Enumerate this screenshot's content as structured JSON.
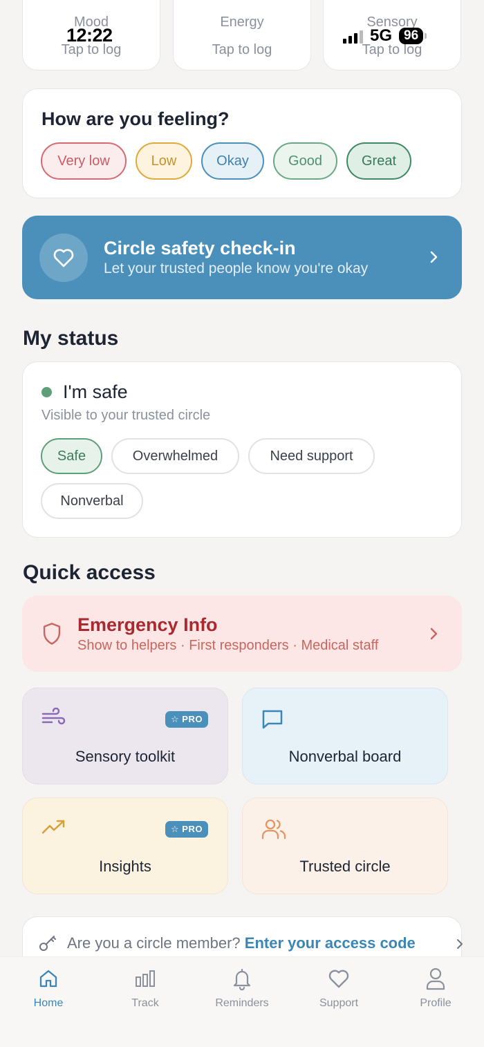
{
  "status_bar": {
    "time": "12:22",
    "network": "5G",
    "battery": "96"
  },
  "trackers": [
    {
      "label": "Mood",
      "action": "Tap to log"
    },
    {
      "label": "Energy",
      "action": "Tap to log"
    },
    {
      "label": "Sensory",
      "action": "Tap to log"
    }
  ],
  "feeling": {
    "title": "How are you feeling?",
    "options": [
      "Very low",
      "Low",
      "Okay",
      "Good",
      "Great"
    ]
  },
  "safety": {
    "title": "Circle safety check-in",
    "subtitle": "Let your trusted people know you're okay"
  },
  "my_status": {
    "heading": "My status",
    "current": "I'm safe",
    "visibility": "Visible to your trusted circle",
    "options": [
      "Safe",
      "Overwhelmed",
      "Need support",
      "Nonverbal"
    ],
    "selected": "Safe"
  },
  "quick_access": {
    "heading": "Quick access",
    "emergency": {
      "title": "Emergency Info",
      "subtitle": "Show to helpers · First responders · Medical staff"
    },
    "tiles": [
      {
        "label": "Sensory toolkit",
        "badge": "PRO",
        "icon": "wind-icon"
      },
      {
        "label": "Nonverbal board",
        "badge": "",
        "icon": "message-square-icon"
      },
      {
        "label": "Insights",
        "badge": "PRO",
        "icon": "trending-up-icon"
      },
      {
        "label": "Trusted circle",
        "badge": "",
        "icon": "users-icon"
      }
    ]
  },
  "access": {
    "prompt": "Are you a circle member?",
    "link": "Enter your access code"
  },
  "nav": {
    "active": "Home",
    "items": [
      "Home",
      "Track",
      "Reminders",
      "Support",
      "Profile"
    ]
  },
  "colors": {
    "accent": "#4a90bb",
    "safe_green": "#5e9e79",
    "emergency_red": "#a8292f",
    "background": "#f5f4f2"
  }
}
